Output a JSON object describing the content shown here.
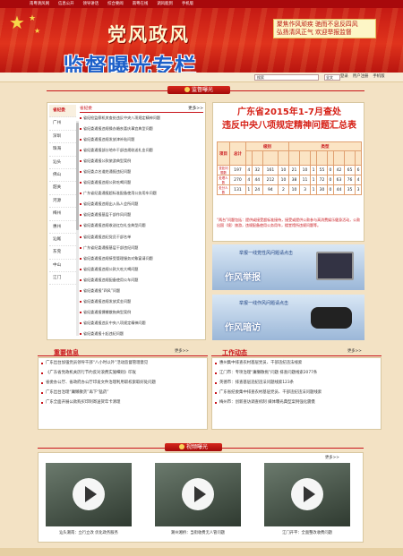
{
  "topnav": {
    "items": [
      "南粤清风网",
      "信息公开",
      "领导讲话",
      "综合要闻",
      "南粤在线",
      "调风能到",
      "手机版"
    ]
  },
  "banner": {
    "title1": "党风政风",
    "title2": "监督曝光专栏",
    "slogan": [
      "聚焦作风顽疾 驰而不息反四风",
      "弘扬清风正气 欢迎举报监督"
    ]
  },
  "search": {
    "placeholder": "搜索",
    "select": "全文",
    "links": [
      "登录",
      "用户注册",
      "手机版"
    ]
  },
  "section_supervise": "监督曝光",
  "tabs": [
    "省纪委",
    "广州",
    "深圳",
    "珠海",
    "汕头",
    "佛山",
    "韶关",
    "河源",
    "梅州",
    "惠州",
    "汕尾",
    "东莞",
    "中山",
    "江门"
  ],
  "list1": {
    "heading": "省纪委",
    "more": "更多>>",
    "items": [
      "省纪检监察机关查处违反中央八项规定精神问题",
      "省纪委通报违规操办婚丧喜庆事宜典型问题",
      "省纪委通报违规发放津补贴问题",
      "省纪委通报部分地市干部违规收送礼金问题",
      "省纪委通报公款旅游典型案例",
      "省纪委点名道姓通报违纪问题",
      "省纪委通报违规公款吃喝问题",
      "广东省纪委通报超标准配备使用公务用车问题",
      "省纪委通报违规出入私人会所问题",
      "省纪委通报基层干部作风问题",
      "省纪委通报违规收送红包礼金典型问题",
      "省纪委通报违纪党员干部名单",
      "广东省纪委通报基层干部违纪问题",
      "省纪委通报违规接受管理服务对象宴请问题",
      "省纪委通报违规公款大吃大喝问题",
      "省纪委通报违规配备使用公车问题",
      "省纪委通报“四风”问题",
      "省纪委通报违规发放奖金问题",
      "省纪委通报慵懒散拖典型案例",
      "省纪委通报违反中央八项规定精神问题",
      "省纪委通报十起违纪问题"
    ]
  },
  "stats": {
    "title1": "广东省2015年1-7月查处",
    "title2": "违反中央八项规定精神问题汇总表",
    "rowhead": "项目",
    "cols": [
      "总计",
      "厅级",
      "处级",
      "科级",
      "其他",
      "",
      "",
      "",
      "",
      ""
    ],
    "group_label": "级别",
    "type_label": "类型",
    "rows": [
      {
        "label": "查处问题数",
        "vals": [
          "197",
          "4",
          "32",
          "161",
          "10",
          "21",
          "10",
          "1",
          "55",
          "0",
          "42",
          "65",
          "6",
          "7"
        ]
      },
      {
        "label": "处理人数",
        "vals": [
          "270",
          "4",
          "44",
          "212",
          "10",
          "38",
          "11",
          "1",
          "72",
          "0",
          "63",
          "76",
          "4",
          "8"
        ]
      },
      {
        "label": "处分人数",
        "vals": [
          "131",
          "1",
          "24",
          "94",
          "2",
          "10",
          "3",
          "1",
          "30",
          "0",
          "44",
          "35",
          "3",
          "5"
        ]
      }
    ],
    "note": "“两台”问题包括：提供或接受超标准接待，接受或提供公款参与高消费娱乐健身活动，公款出国（境）旅游，违规配备使用公务用车，楼堂馆所违规问题等。"
  },
  "ad1": {
    "text": "举报一线党性风问题请点击",
    "big": "作风举报"
  },
  "ad2": {
    "text": "举报一线作风问题请点击",
    "big": "作风暗访"
  },
  "news": {
    "title": "重要信息",
    "more": "更多>>",
    "items": [
      "广东出台加强党员领导干部“八小时以外”活动监督管理意见",
      "《广东省党政机关厉行节约反对浪费实施细则》印发",
      "省委办公厅、省政府办公厅印发文件治理利用职权索取好处问题",
      "广东出台治理“庸懒散贪”再下“猛药”",
      "广东全面开展公款购买印制寄送贺年卡清理"
    ]
  },
  "work": {
    "title": "工作动态",
    "more": "更多>>",
    "items": [
      "惠州集中排查农村基层党员、干部违纪违法线索",
      "江门市：专项治理“庸懒散拖”问题 排查问题线索2077条",
      "英德市：排查基层违纪违法问题线索123条",
      "广东省纪委集中排查农村基层党员、干部违纪违法问题线索",
      "梅州市：创新查访调查机制 媒体曝光典型案例强化震慑"
    ]
  },
  "video": {
    "title": "视频曝光",
    "more": "更多>>",
    "items": [
      {
        "caption": "汕头潮南：立行立改 优化政务服务"
      },
      {
        "caption": "潮州湘桥：当街收费无人管问题"
      },
      {
        "caption": "江门开平：全面整改收费问题"
      }
    ]
  }
}
